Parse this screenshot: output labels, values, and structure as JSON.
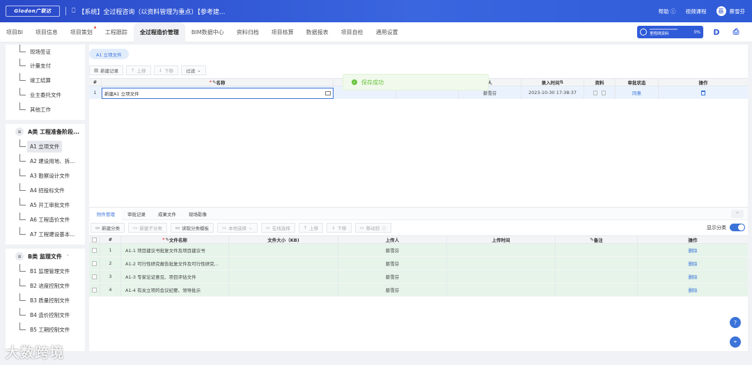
{
  "topbar": {
    "logo": "Glodon广联达",
    "title": "【系统】全过程咨询（以资料管理为重点）【参考建...",
    "help": "帮助",
    "video_course": "视频课程",
    "user_name": "蔡雪芬",
    "avatar_initial": "蔡"
  },
  "nav": {
    "tabs": [
      "项目BI",
      "项目信息",
      "项目策划",
      "工程跟踪",
      "全过程造价管理",
      "BIM数据中心",
      "资料归档",
      "项目核算",
      "数据报表",
      "项目自检",
      "通用设置"
    ],
    "active_index": 4,
    "progress_label": "里程碑资料",
    "progress_pct": "0%",
    "progress_value": 0
  },
  "sidebar": {
    "top_items": [
      "现场签证",
      "计量支付",
      "竣工结算",
      "业主委托文件",
      "其他工作"
    ],
    "group_a": {
      "title": "A类 工程准备阶段...",
      "items": [
        "A1 立项文件",
        "A2 建设用地、拆...",
        "A3 勘察设计文件",
        "A4 招投标文件",
        "A5 开工审批文件",
        "A6 工程造价文件",
        "A7 工程建设基本..."
      ],
      "active_index": 0
    },
    "group_b": {
      "title": "B类 监理文件",
      "items": [
        "B1 监理管理文件",
        "B2 进度控制文件",
        "B3 质量控制文件",
        "B4 造价控制文件",
        "B5 工期控制文件"
      ]
    }
  },
  "main": {
    "chip": "A1 立项文件",
    "toolbar": {
      "new_record": "新建记录",
      "move_up": "上移",
      "move_down": "下移",
      "filter": "过滤"
    },
    "headers": {
      "num": "#",
      "name": "名称",
      "entrant": "人",
      "entry_time": "录入时间",
      "material": "资料",
      "approval": "审批状态",
      "action": "操作"
    },
    "row": {
      "num": "1",
      "name_value": "新建A1 立项文件",
      "entrant": "蔡雪芬",
      "entry_time": "2023-10-30 17:38:37",
      "approval": "同意"
    },
    "toast": "保存成功"
  },
  "lower": {
    "tabs": [
      "附件管理",
      "审批记录",
      "成果文件",
      "现场影像"
    ],
    "active_tab": 0,
    "toolbar": [
      "新建分类",
      "新建子分类",
      "读取分类模板",
      "本地选择",
      "在线选择",
      "上移",
      "下移",
      "移动到"
    ],
    "show_category": "显示分类",
    "headers": {
      "num": "#",
      "file_name": "文件名称",
      "file_size": "文件大小（KB)",
      "uploader": "上传人",
      "upload_time": "上传时间",
      "remark": "备注",
      "action": "操作"
    },
    "rows": [
      {
        "num": "1",
        "name": "A1-1 项目建议书批复文件及项目建议书",
        "uploader": "蔡雪芬",
        "action": "删除"
      },
      {
        "num": "2",
        "name": "A1-2 可行性研究报告批复文件及可行性研究...",
        "uploader": "蔡雪芬",
        "action": "删除"
      },
      {
        "num": "3",
        "name": "A1-3 专家论证意见、项目评估文件",
        "uploader": "蔡雪芬",
        "action": "删除"
      },
      {
        "num": "4",
        "name": "A1-4 有关立项的会议纪要、领导批示",
        "uploader": "蔡雪芬",
        "action": "删除"
      }
    ]
  },
  "watermark": "大数跨境",
  "colors": {
    "primary": "#3b73d9",
    "topbar": "#2a49c9",
    "success": "#67c23a",
    "row_green": "#e6f4ea"
  }
}
